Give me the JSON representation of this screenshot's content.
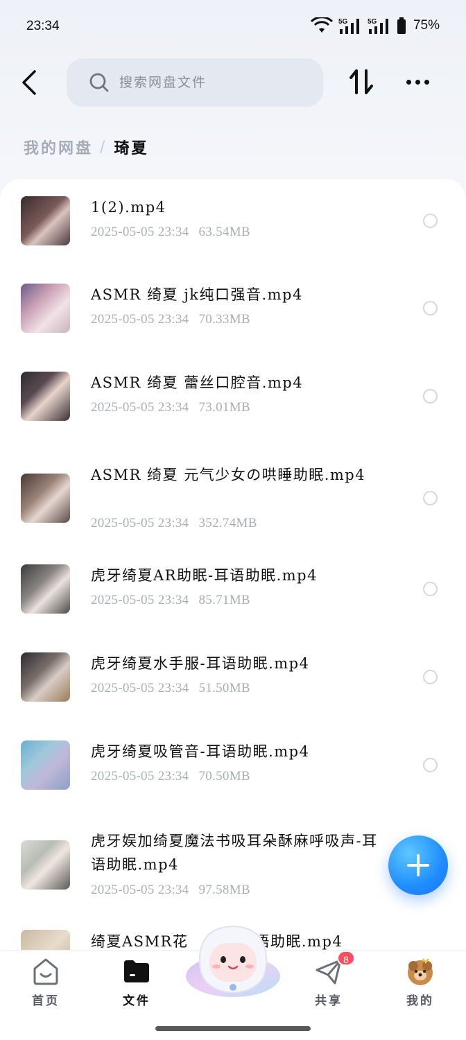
{
  "status": {
    "time": "23:34",
    "battery": "75%"
  },
  "header": {
    "search_placeholder": "搜索网盘文件"
  },
  "breadcrumb": {
    "root": "我的网盘",
    "separator": "/",
    "current": "琦夏"
  },
  "files": [
    {
      "name": "1(2).mp4",
      "date": "2025-05-05 23:34",
      "size": "63.54MB"
    },
    {
      "name": "ASMR 绮夏 jk纯口强音.mp4",
      "date": "2025-05-05 23:34",
      "size": "70.33MB"
    },
    {
      "name": "ASMR 绮夏  蕾丝口腔音.mp4",
      "date": "2025-05-05 23:34",
      "size": "73.01MB"
    },
    {
      "name": "ASMR 绮夏  元气少女の哄睡助眠.mp4",
      "date": "2025-05-05 23:34",
      "size": "352.74MB"
    },
    {
      "name": "虎牙绮夏AR助眠-耳语助眠.mp4",
      "date": "2025-05-05 23:34",
      "size": "85.71MB"
    },
    {
      "name": "虎牙绮夏水手服-耳语助眠.mp4",
      "date": "2025-05-05 23:34",
      "size": "51.50MB"
    },
    {
      "name": "虎牙绮夏吸管音-耳语助眠.mp4",
      "date": "2025-05-05 23:34",
      "size": "70.50MB"
    },
    {
      "name": "虎牙娱加绮夏魔法书吸耳朵酥麻呼吸声-耳语助眠.mp4",
      "date": "2025-05-05 23:34",
      "size": "97.58MB"
    },
    {
      "name": "绮夏ASMR花",
      "name_tail": "语助眠.mp4",
      "date": "",
      "size": ""
    }
  ],
  "nav": {
    "home": "首页",
    "files": "文件",
    "share": "共享",
    "share_badge": "8",
    "me": "我的"
  },
  "colors": {
    "accent": "#1f8cff",
    "badge": "#ff4d5e",
    "meta_text": "#a9adb6"
  },
  "icons": [
    "back-icon",
    "search-icon",
    "sort-icon",
    "more-icon",
    "plus-icon",
    "home-icon",
    "folder-icon",
    "send-icon",
    "avatar"
  ]
}
